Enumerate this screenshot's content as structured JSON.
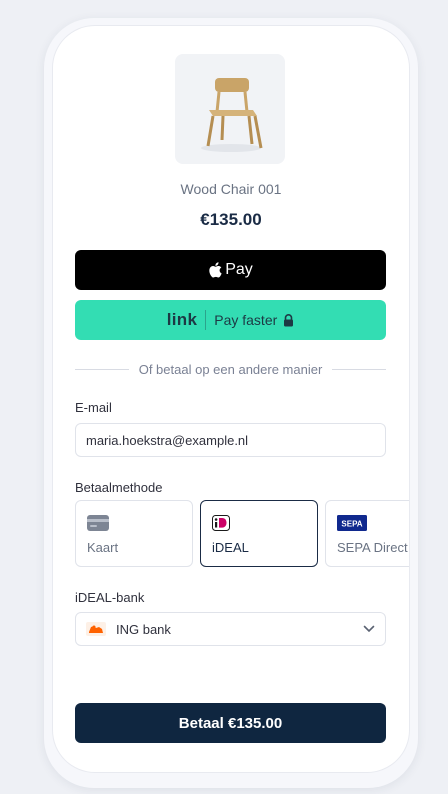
{
  "product": {
    "name": "Wood Chair 001",
    "price": "€135.00",
    "image_icon": "chair-image"
  },
  "wallets": {
    "apple_pay_label": "Pay",
    "link_logo": "link",
    "link_label": "Pay faster"
  },
  "divider_text": "Of betaal op een andere manier",
  "email": {
    "label": "E-mail",
    "value": "maria.hoekstra@example.nl"
  },
  "payment_method": {
    "label": "Betaalmethode",
    "options": [
      {
        "label": "Kaart",
        "icon": "card-icon",
        "selected": false
      },
      {
        "label": "iDEAL",
        "icon": "ideal-icon",
        "selected": true
      },
      {
        "label": "SEPA Direct Debit",
        "icon": "sepa-icon",
        "selected": false
      }
    ],
    "sepa_icon_text": "SEPA"
  },
  "bank": {
    "label": "iDEAL-bank",
    "selected": "ING bank",
    "icon": "ing-lion-icon"
  },
  "pay_button_label": "Betaal €135.00",
  "colors": {
    "primary": "#0f2640",
    "link_green": "#33ddb3",
    "ideal_pink": "#cc0066",
    "sepa_blue": "#10298e"
  }
}
